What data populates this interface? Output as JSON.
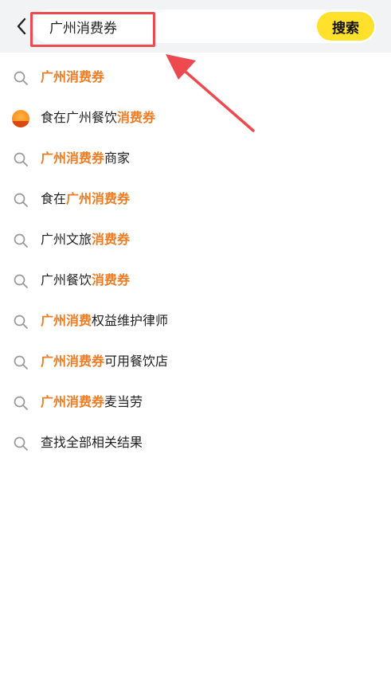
{
  "search": {
    "value": "广州消费券",
    "button_label": "搜索"
  },
  "colors": {
    "accent": "#ee7c22",
    "button_bg": "#ffe02a",
    "annotation": "#ec4a4f"
  },
  "suggestions": [
    {
      "icon": "search-icon",
      "parts": [
        {
          "t": "广州消费券",
          "hl": true
        }
      ]
    },
    {
      "icon": "food-badge-icon",
      "parts": [
        {
          "t": "食在广州餐饮",
          "hl": false
        },
        {
          "t": "消费券",
          "hl": true
        }
      ]
    },
    {
      "icon": "search-icon",
      "parts": [
        {
          "t": "广州消费券",
          "hl": true
        },
        {
          "t": "商家",
          "hl": false
        }
      ]
    },
    {
      "icon": "search-icon",
      "parts": [
        {
          "t": "食在",
          "hl": false
        },
        {
          "t": "广州消费券",
          "hl": true
        }
      ]
    },
    {
      "icon": "search-icon",
      "parts": [
        {
          "t": "广州文旅",
          "hl": false
        },
        {
          "t": "消费券",
          "hl": true
        }
      ]
    },
    {
      "icon": "search-icon",
      "parts": [
        {
          "t": "广州餐饮",
          "hl": false
        },
        {
          "t": "消费券",
          "hl": true
        }
      ]
    },
    {
      "icon": "search-icon",
      "parts": [
        {
          "t": "广州消费",
          "hl": true
        },
        {
          "t": "权益维护律师",
          "hl": false
        }
      ]
    },
    {
      "icon": "search-icon",
      "parts": [
        {
          "t": "广州消费券",
          "hl": true
        },
        {
          "t": "可用餐饮店",
          "hl": false
        }
      ]
    },
    {
      "icon": "search-icon",
      "parts": [
        {
          "t": "广州消费券",
          "hl": true
        },
        {
          "t": "麦当劳",
          "hl": false
        }
      ]
    },
    {
      "icon": "search-icon",
      "parts": [
        {
          "t": "查找全部相关结果",
          "hl": false
        }
      ]
    }
  ]
}
